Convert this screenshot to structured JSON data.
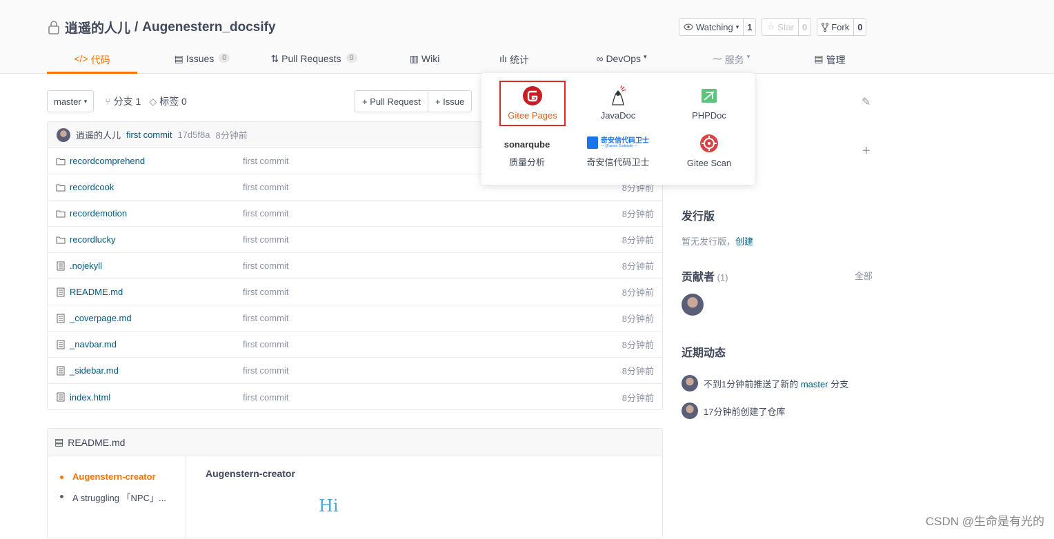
{
  "repo": {
    "owner": "逍遥的人儿",
    "sep": "/",
    "name": "Augenestern_docsify"
  },
  "actions": [
    {
      "label": "Watching",
      "count": "1",
      "icon": "eye-icon"
    },
    {
      "label": "Star",
      "count": "0",
      "icon": "star-icon"
    },
    {
      "label": "Fork",
      "count": "0",
      "icon": "fork-icon"
    }
  ],
  "tabs": [
    {
      "label": "代码",
      "icon": "code-icon"
    },
    {
      "label": "Issues",
      "badge": "0",
      "icon": "issues-icon"
    },
    {
      "label": "Pull Requests",
      "badge": "0",
      "icon": "pull-request-icon"
    },
    {
      "label": "Wiki",
      "icon": "wiki-icon"
    },
    {
      "label": "统计",
      "icon": "stats-icon"
    },
    {
      "label": "DevOps",
      "icon": "devops-icon"
    },
    {
      "label": "服务",
      "icon": "service-icon"
    },
    {
      "label": "管理",
      "icon": "manage-icon"
    }
  ],
  "toolbar": {
    "branch": "master",
    "branches": "分支 1",
    "tags": "标签 0",
    "pull_request": "+ Pull Request",
    "issue": "+ Issue"
  },
  "commit": {
    "author": "逍遥的人儿",
    "message": "first commit",
    "hash": "17d5f8a",
    "time": "8分钟前"
  },
  "files": [
    {
      "name": "recordcomprehend",
      "type": "folder",
      "msg": "first commit",
      "time": ""
    },
    {
      "name": "recordcook",
      "type": "folder",
      "msg": "first commit",
      "time": "8分钟前"
    },
    {
      "name": "recordemotion",
      "type": "folder",
      "msg": "first commit",
      "time": "8分钟前"
    },
    {
      "name": "recordlucky",
      "type": "folder",
      "msg": "first commit",
      "time": "8分钟前"
    },
    {
      "name": ".nojekyll",
      "type": "file",
      "msg": "first commit",
      "time": "8分钟前"
    },
    {
      "name": "README.md",
      "type": "file",
      "msg": "first commit",
      "time": "8分钟前"
    },
    {
      "name": "_coverpage.md",
      "type": "file",
      "msg": "first commit",
      "time": "8分钟前"
    },
    {
      "name": "_navbar.md",
      "type": "file",
      "msg": "first commit",
      "time": "8分钟前"
    },
    {
      "name": "_sidebar.md",
      "type": "file",
      "msg": "first commit",
      "time": "8分钟前"
    },
    {
      "name": "index.html",
      "type": "file",
      "msg": "first commit",
      "time": "8分钟前"
    }
  ],
  "readme": {
    "title": "README.md",
    "toc": [
      "Augenstern-creator",
      "A struggling 「NPC」..."
    ],
    "heading": "Augenstern-creator",
    "hi": "Hi"
  },
  "side": {
    "release_title": "发行版",
    "release_text": "暂无发行版，",
    "release_link": "创建",
    "contrib_title": "贡献者",
    "contrib_count": "(1)",
    "contrib_all": "全部",
    "activity_title": "近期动态",
    "activity": [
      {
        "pre": "不到1分钟前推送了新的 ",
        "link": "master",
        "post": " 分支"
      },
      {
        "pre": "17分钟前创建了仓库",
        "link": "",
        "post": ""
      }
    ]
  },
  "services": [
    {
      "label": "Gitee Pages",
      "icon": "gitee-pages-icon"
    },
    {
      "label": "JavaDoc",
      "icon": "javadoc-icon"
    },
    {
      "label": "PHPDoc",
      "icon": "phpdoc-icon"
    },
    {
      "label": "质量分析",
      "icon": "sonarqube-icon",
      "logo_text": "sonarqube"
    },
    {
      "label": "奇安信代码卫士",
      "icon": "qianxin-codesafe-icon",
      "logo_text": "奇安信代码卫士",
      "logo_sub": "— Qi'anxin Codesafe —"
    },
    {
      "label": "Gitee Scan",
      "icon": "gitee-scan-icon"
    }
  ],
  "watermark": "CSDN @生命是有光的",
  "colors": {
    "accent": "#fe7300",
    "link": "#005980",
    "highlight_border": "#e02828"
  }
}
